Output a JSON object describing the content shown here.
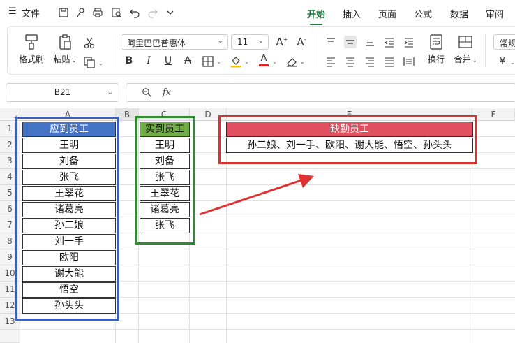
{
  "menubar": {
    "menu_label": "文件",
    "tabs": [
      {
        "label": "开始",
        "active": true
      },
      {
        "label": "插入",
        "active": false
      },
      {
        "label": "页面",
        "active": false
      },
      {
        "label": "公式",
        "active": false
      },
      {
        "label": "数据",
        "active": false
      },
      {
        "label": "审阅",
        "active": false
      }
    ]
  },
  "ribbon": {
    "format_painter": "格式刷",
    "paste": "粘贴",
    "font_name": "阿里巴巴普惠体",
    "font_size": "11",
    "wrap": "换行",
    "merge": "合并",
    "number_format": "常规",
    "bold": "B",
    "italic": "I",
    "underline": "U",
    "strike": "A",
    "font_color_letter": "A",
    "currency": "¥"
  },
  "formula_bar": {
    "name_box": "B21",
    "fx_label": "fx",
    "formula": ""
  },
  "grid": {
    "columns": [
      "A",
      "B",
      "C",
      "D",
      "E",
      "F"
    ],
    "rows": [
      "1",
      "2",
      "3",
      "4",
      "5",
      "6",
      "7",
      "8",
      "9",
      "10",
      "11",
      "12",
      "13"
    ],
    "table_a": {
      "header": "应到员工",
      "items": [
        "王明",
        "刘备",
        "张飞",
        "王翠花",
        "诸葛亮",
        "孙二娘",
        "刘一手",
        "欧阳",
        "谢大能",
        "悟空",
        "孙头头"
      ]
    },
    "table_c": {
      "header": "实到员工",
      "items": [
        "王明",
        "刘备",
        "张飞",
        "王翠花",
        "诸葛亮",
        "张飞"
      ]
    },
    "table_e": {
      "header": "缺勤员工",
      "value": "孙二娘、刘一手、欧阳、谢大能、悟空、孙头头"
    }
  },
  "colors": {
    "accent_green": "#1a7a3c",
    "header_blue": "#4472c4",
    "header_green": "#70ad47",
    "header_red": "#e05060",
    "outline_blue": "#3b5fc0",
    "outline_green": "#2e8b2e",
    "outline_red": "#e03030",
    "arrow_red": "#e03030"
  }
}
